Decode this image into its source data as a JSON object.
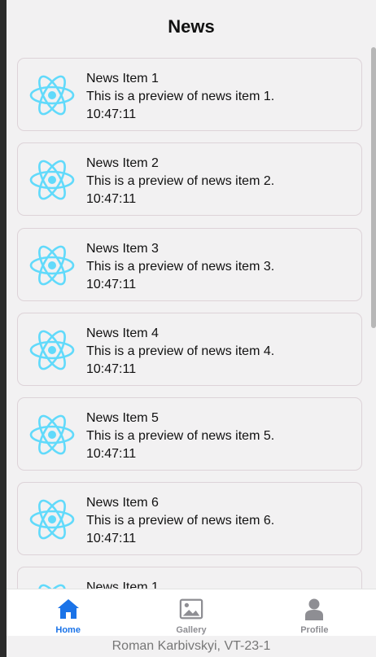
{
  "header": {
    "title": "News"
  },
  "news": {
    "items": [
      {
        "title": "News Item 1",
        "preview": "This is a preview of news item 1.",
        "time": "10:47:11"
      },
      {
        "title": "News Item 2",
        "preview": "This is a preview of news item 2.",
        "time": "10:47:11"
      },
      {
        "title": "News Item 3",
        "preview": "This is a preview of news item 3.",
        "time": "10:47:11"
      },
      {
        "title": "News Item 4",
        "preview": "This is a preview of news item 4.",
        "time": "10:47:11"
      },
      {
        "title": "News Item 5",
        "preview": "This is a preview of news item 5.",
        "time": "10:47:11"
      },
      {
        "title": "News Item 6",
        "preview": "This is a preview of news item 6.",
        "time": "10:47:11"
      },
      {
        "title": "News Item 1",
        "preview": "",
        "time": ""
      }
    ],
    "item_icon": "react-logo-icon"
  },
  "tabs": [
    {
      "label": "Home",
      "icon": "home-icon",
      "active": true
    },
    {
      "label": "Gallery",
      "icon": "image-icon",
      "active": false
    },
    {
      "label": "Profile",
      "icon": "person-icon",
      "active": false
    }
  ],
  "footer": {
    "text": "Roman Karbivskyi, VT-23-1"
  },
  "colors": {
    "accent": "#1a73e8",
    "react_logo": "#61dafb",
    "inactive_tab": "#8e8e93",
    "background": "#f2f1f2"
  }
}
